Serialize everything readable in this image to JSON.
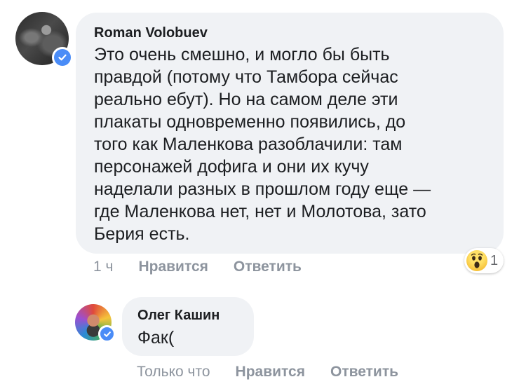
{
  "comment": {
    "author": "Roman Volobuev",
    "text": "Это очень смешно, и могло бы быть\nправдой (потому что Тамбора сейчас\nреально ебут).  Но на самом деле эти\nплакаты одновременно появились, до\nтого как Маленкова разоблачили: там\nперсонажей дофига и они их кучу\nнаделали разных в прошлом году еще —\nгде Маленкова нет,  нет и Молотова, зато\nБерия есть.",
    "time": "1 ч",
    "like_label": "Нравится",
    "reply_label": "Ответить",
    "reaction": {
      "icon": "wow-emoji-icon",
      "count": "1"
    }
  },
  "reply": {
    "author": "Олег Кашин",
    "text": "Фак(",
    "time": "Только что",
    "like_label": "Нравится",
    "reply_label": "Ответить"
  },
  "colors": {
    "bubble": "#f0f2f5",
    "verified": "#4a8cf7",
    "meta_text": "#8d949e"
  }
}
